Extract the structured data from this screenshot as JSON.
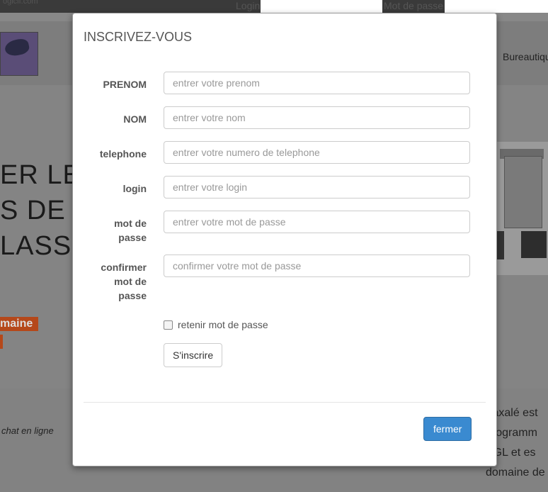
{
  "background": {
    "brand_tiny": "ogiclf.com",
    "login_label": "Login",
    "password_label": "Mot de passe",
    "nav_link": "Bureautique",
    "hero_lines": [
      "ER LE",
      "S DE B",
      "LASSE"
    ],
    "badge_text": "maine",
    "chat_text": "chat en ligne",
    "right_text": [
      "Vaxalé est",
      "programm",
      "PGL et es",
      "domaine de"
    ]
  },
  "modal": {
    "title": "INSCRIVEZ-VOUS",
    "fields": [
      {
        "label": "PRENOM",
        "placeholder": "entrer votre prenom"
      },
      {
        "label": "NOM",
        "placeholder": "entrer votre nom"
      },
      {
        "label": "telephone",
        "placeholder": "entrer votre numero de telephone"
      },
      {
        "label": "login",
        "placeholder": "entrer votre login"
      },
      {
        "label": "mot de passe",
        "placeholder": "entrer votre mot de passe"
      },
      {
        "label": "confirmer mot de passe",
        "placeholder": "confirmer votre mot de passe"
      }
    ],
    "remember_label": "retenir mot de passe",
    "remember_checked": false,
    "submit_label": "S'inscrire",
    "close_label": "fermer"
  },
  "colors": {
    "primary_button": "#3a8ad0",
    "overlay_orange": "#b5481a"
  }
}
